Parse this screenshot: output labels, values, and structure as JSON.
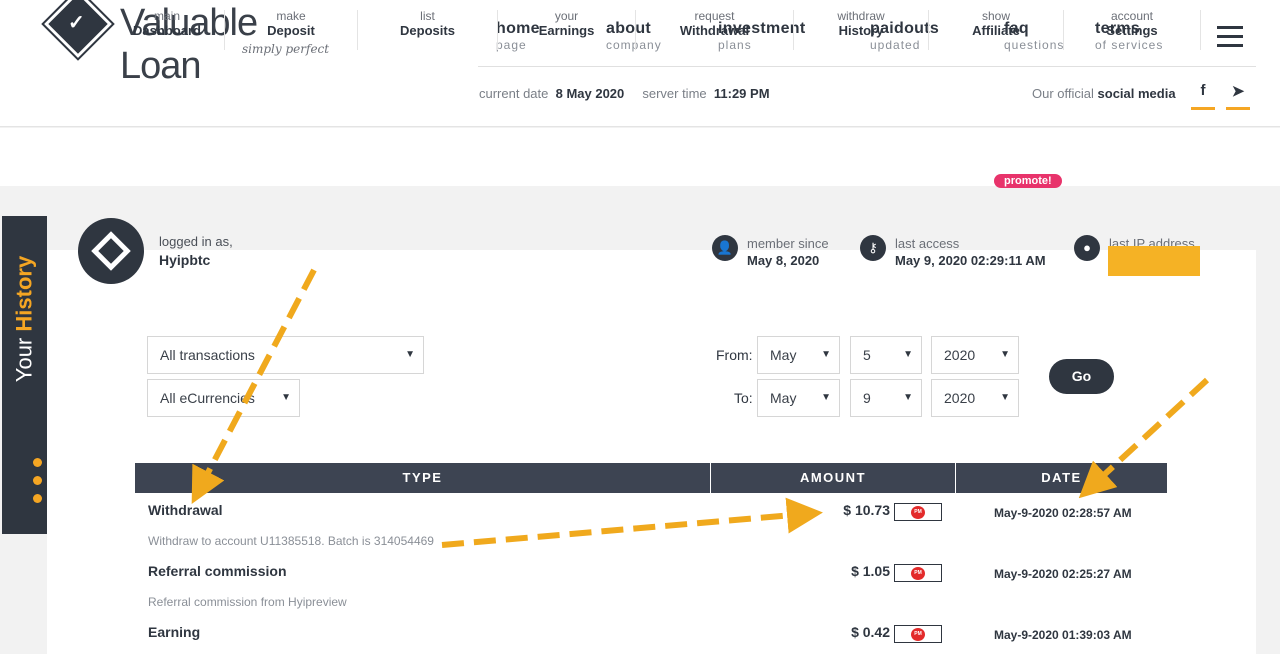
{
  "brand": {
    "name": "Valuable Loan",
    "tagline": "simply perfect"
  },
  "nav": [
    {
      "title": "home",
      "sub": "page"
    },
    {
      "title": "about",
      "sub": "company"
    },
    {
      "title": "investment",
      "sub": "plans"
    },
    {
      "title": "paidouts",
      "sub": "updated"
    },
    {
      "title": "faq",
      "sub": "questions"
    },
    {
      "title": "terms",
      "sub": "of services"
    }
  ],
  "info": {
    "current_date_label": "current date",
    "current_date": "8 May 2020",
    "server_time_label": "server time",
    "server_time": "11:29 PM",
    "social_label": "Our official",
    "social_bold": "social media"
  },
  "subnav": [
    {
      "small": "main",
      "big": "Dashboard"
    },
    {
      "small": "make",
      "big": "Deposit"
    },
    {
      "small": "list",
      "big": "Deposits"
    },
    {
      "small": "your",
      "big": "Earnings"
    },
    {
      "small": "request",
      "big": "Withdrawal"
    },
    {
      "small": "withdraw",
      "big": "History"
    },
    {
      "small": "show",
      "big": "Affiliate"
    },
    {
      "small": "account",
      "big": "Settings"
    }
  ],
  "promote_badge": "promote!",
  "sidebar": {
    "prefix": "Your",
    "highlight": "History"
  },
  "user": {
    "logged_label": "logged in as,",
    "username": "Hyipbtc",
    "member_since_label": "member since",
    "member_since": "May 8, 2020",
    "last_access_label": "last access",
    "last_access": "May 9, 2020 02:29:11 AM",
    "last_ip_label": "last IP address"
  },
  "filters": {
    "type": "All transactions",
    "currency": "All eCurrencies",
    "from_label": "From:",
    "to_label": "To:",
    "from": {
      "month": "May",
      "day": "5",
      "year": "2020"
    },
    "to": {
      "month": "May",
      "day": "9",
      "year": "2020"
    },
    "go": "Go"
  },
  "table": {
    "headers": [
      "TYPE",
      "AMOUNT",
      "DATE"
    ],
    "rows": [
      {
        "type": "Withdrawal",
        "desc": "Withdraw to account U11385518. Batch is 314054469",
        "amount": "$ 10.73",
        "date": "May-9-2020 02:28:57 AM"
      },
      {
        "type": "Referral commission",
        "desc": "Referral commission from Hyipreview",
        "amount": "$ 1.05",
        "date": "May-9-2020 02:25:27 AM"
      },
      {
        "type": "Earning",
        "desc": "",
        "amount": "$ 0.42",
        "date": "May-9-2020 01:39:03 AM"
      }
    ],
    "pm_badge": "PM"
  },
  "colors": {
    "accent": "#f5a623",
    "dark": "#2f3640",
    "promote": "#e8336b"
  }
}
